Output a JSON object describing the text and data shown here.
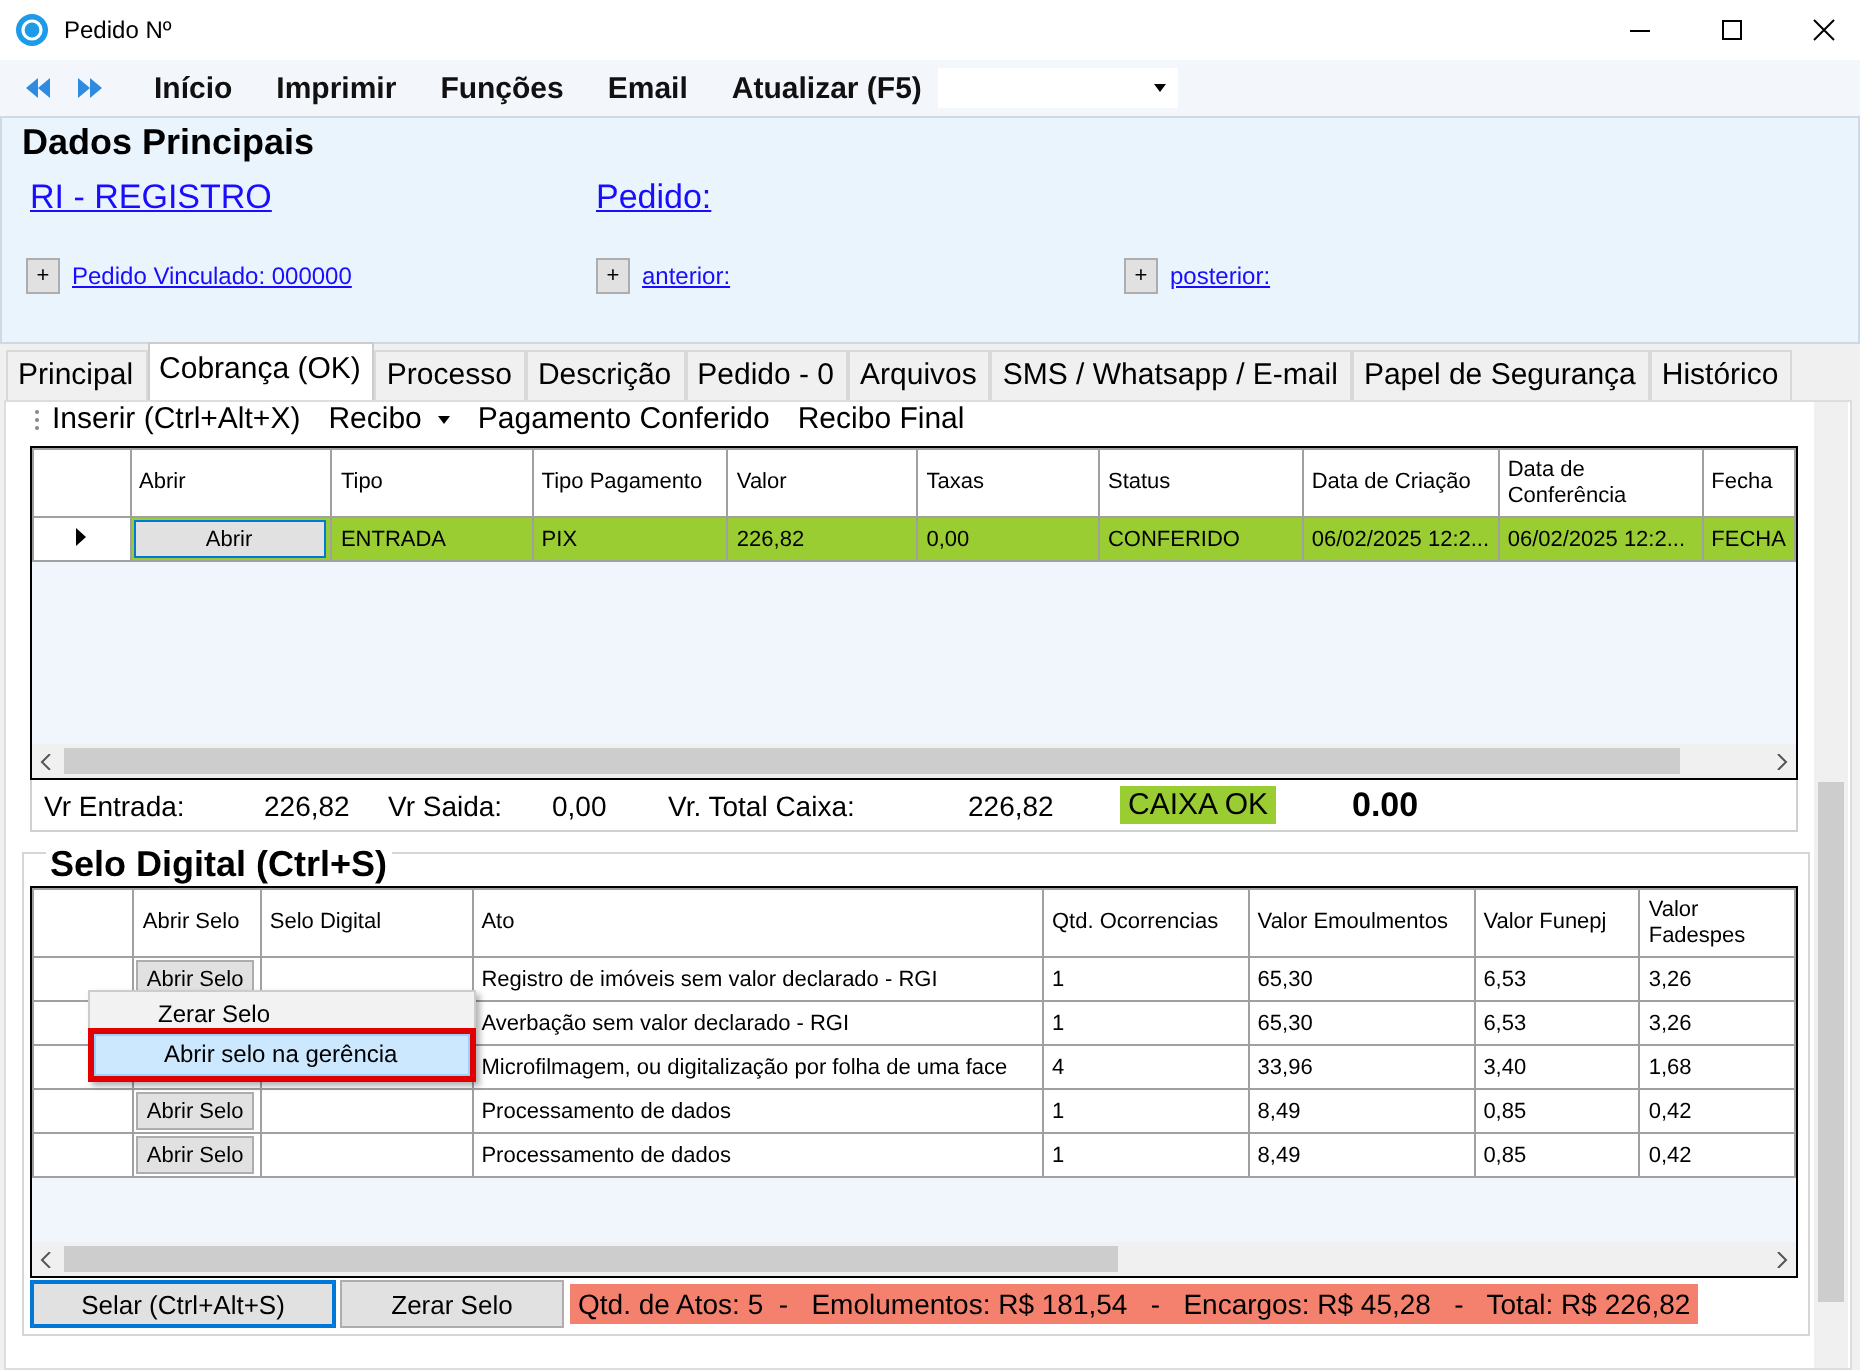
{
  "window": {
    "title": "Pedido Nº"
  },
  "menu": {
    "items": [
      "Início",
      "Imprimir",
      "Funções",
      "Email",
      "Atualizar (F5)"
    ]
  },
  "dados_principais": {
    "title": "Dados Principais",
    "system": "RI - REGISTRO",
    "pedido": "Pedido:",
    "links": [
      {
        "button": "+",
        "label": "Pedido Vinculado: 000000"
      },
      {
        "button": "+",
        "label": "anterior:"
      },
      {
        "button": "+",
        "label": "posterior:"
      }
    ]
  },
  "tabs": [
    {
      "label": "Principal",
      "selected": false
    },
    {
      "label": "Cobrança (OK)",
      "selected": true
    },
    {
      "label": "Processo",
      "selected": false
    },
    {
      "label": "Descrição",
      "selected": false
    },
    {
      "label": "Pedido - 0",
      "selected": false
    },
    {
      "label": "Arquivos",
      "selected": false
    },
    {
      "label": "SMS / Whatsapp / E-mail",
      "selected": false
    },
    {
      "label": "Papel de Segurança",
      "selected": false
    },
    {
      "label": "Histórico",
      "selected": false
    }
  ],
  "toolbar": [
    {
      "kind": "button",
      "label": "Inserir (Ctrl+Alt+X)"
    },
    {
      "kind": "dropdown",
      "label": "Recibo"
    },
    {
      "kind": "button",
      "label": "Pagamento Conferido"
    },
    {
      "kind": "button",
      "label": "Recibo Final"
    }
  ],
  "payments": {
    "columns": [
      "Abrir",
      "Tipo",
      "Tipo Pagamento",
      "Valor",
      "Taxas",
      "Status",
      "Data de Criação",
      "Data de Conferência",
      "Fecha"
    ],
    "rows": [
      {
        "current": true,
        "highlighted": true,
        "cells": [
          "Abrir",
          "ENTRADA",
          "PIX",
          "226,82",
          "0,00",
          "CONFERIDO",
          "06/02/2025 12:2...",
          "06/02/2025 12:2...",
          "FECHA"
        ]
      }
    ]
  },
  "totals": [
    {
      "label": "Vr Entrada:",
      "value": "226,82"
    },
    {
      "label": "Vr Saida:",
      "value": "0,00"
    },
    {
      "label": "Vr. Total Caixa:",
      "value": "226,82"
    }
  ],
  "caixa_status": "CAIXA OK",
  "caixa_difference": "0.00",
  "selo": {
    "title": "Selo Digital (Ctrl+S)",
    "columns": [
      "Abrir Selo",
      "Selo Digital",
      "Ato",
      "Qtd. Ocorrencias",
      "Valor Emoulmentos",
      "Valor Funepj",
      "Valor Fadespes"
    ],
    "rows": [
      {
        "cells": [
          "Abrir Selo",
          "",
          "Registro de imóveis sem valor declarado - RGI",
          "1",
          "65,30",
          "6,53",
          "3,26"
        ]
      },
      {
        "cells": [
          "",
          "",
          "Averbação sem valor declarado - RGI",
          "1",
          "65,30",
          "6,53",
          "3,26"
        ]
      },
      {
        "cells": [
          "",
          "",
          "Microfilmagem, ou digitalização por folha de uma face",
          "4",
          "33,96",
          "3,40",
          "1,68"
        ]
      },
      {
        "cells": [
          "Abrir Selo",
          "",
          "Processamento de dados",
          "1",
          "8,49",
          "0,85",
          "0,42"
        ]
      },
      {
        "cells": [
          "Abrir Selo",
          "",
          "Processamento de dados",
          "1",
          "8,49",
          "0,85",
          "0,42"
        ]
      }
    ]
  },
  "context_menu": [
    {
      "label": "Zerar Selo",
      "selected": false
    },
    {
      "label": "Abrir selo na gerência",
      "selected": true
    }
  ],
  "buttons": [
    {
      "label": "Selar (Ctrl+Alt+S)",
      "focused": true
    },
    {
      "label": "Zerar Selo",
      "focused": false
    }
  ],
  "summary": "Qtd. de Atos: 5  -   Emolumentos: R$ 181,54   -   Encargos: R$ 45,28   -   Total: R$ 226,82"
}
